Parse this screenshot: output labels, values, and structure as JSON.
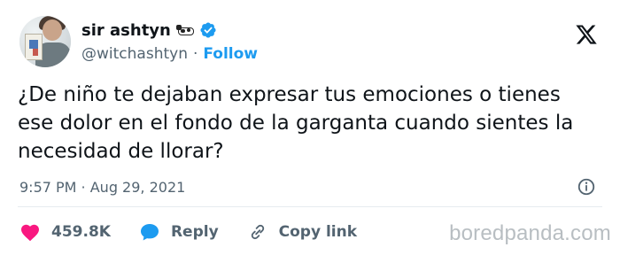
{
  "author": {
    "display_name": "sir ashtyn",
    "handle": "@witchashtyn",
    "separator": "·",
    "follow_label": "Follow",
    "verified": true
  },
  "tweet": {
    "text": "¿De niño te dejaban expresar tus emociones o tienes ese dolor en el fondo de la garganta cuando sientes la necesidad de llorar?",
    "timestamp": "9:57 PM · Aug 29, 2021"
  },
  "actions": {
    "likes_count": "459.8K",
    "reply_label": "Reply",
    "copy_link_label": "Copy link"
  },
  "watermark": "boredpanda.com",
  "colors": {
    "accent": "#1d9bf0",
    "like": "#f91880",
    "text": "#0f1419",
    "muted": "#536471"
  },
  "icons": {
    "brand": "x-logo",
    "info": "info-icon",
    "like": "heart-icon",
    "reply": "speech-bubble-icon",
    "copy": "link-icon",
    "verified": "verified-badge-icon",
    "emoji": "cow-emoji"
  }
}
